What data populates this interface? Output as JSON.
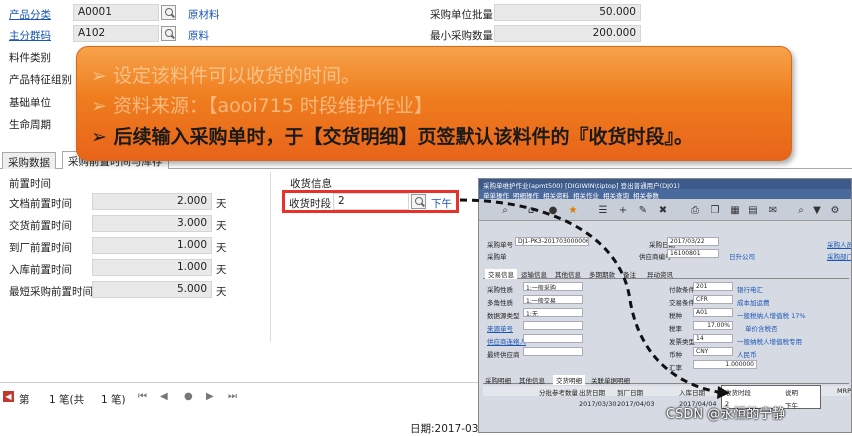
{
  "top_form": {
    "product_category": {
      "label": "产品分类",
      "value": "A0001",
      "desc": "原材料"
    },
    "main_group": {
      "label": "主分群码",
      "value": "A102",
      "desc": "原料"
    },
    "material_type_label": "料件类别",
    "product_feature_label": "产品特征组别",
    "base_unit_label": "基础单位",
    "lifecycle_label": "生命周期",
    "purchase_batch": {
      "label": "采购单位批量",
      "value": "50.000"
    },
    "min_purchase": {
      "label": "最小采购数量",
      "value": "200.000"
    }
  },
  "overlay": {
    "line1": "➢ 设定该料件可以收货的时间。",
    "line2": "➢ 资料来源：【aooi715 时段维护作业】",
    "line3": "➢ 后续输入采购单时，于【交货明细】页签默认该料件的『收货时段』。"
  },
  "tabs": [
    "采购数据",
    "采购前置时间与库存"
  ],
  "lead_time": {
    "section_title": "前置时间",
    "rows": [
      {
        "label": "文档前置时间",
        "value": "2.000",
        "unit": "天"
      },
      {
        "label": "交货前置时间",
        "value": "3.000",
        "unit": "天"
      },
      {
        "label": "到厂前置时间",
        "value": "1.000",
        "unit": "天"
      },
      {
        "label": "入库前置时间",
        "value": "1.000",
        "unit": "天"
      },
      {
        "label": "最短采购前置时间",
        "value": "5.000",
        "unit": "天"
      }
    ]
  },
  "receipt": {
    "section_title": "收货信息",
    "slot_label": "收货时段",
    "slot_value": "2",
    "slot_desc": "下午"
  },
  "nav": {
    "first_label": "第",
    "position": "1 笔(共",
    "total": "1 笔)"
  },
  "date_label": "日期:2017-03-",
  "watermark": "CSDN @永恒的宁静",
  "inset": {
    "title": "采购单维护作业(apmt500)  [DIGIWIN\\tiptop]  登出普通用户(DJ01)",
    "menu": [
      "单单操作",
      "明细操作",
      "相关资料",
      "相关作业",
      "相关查询",
      "相关参数"
    ],
    "po_no_label": "采购单号",
    "po_no": "DJ1-PK3-201703000006",
    "po_date_label": "采购日期",
    "po_date": "2017/03/22",
    "supplier_label": "供应商编号",
    "supplier": "16100801",
    "supplier_name": "日升公司",
    "po_type": "采购单",
    "right_links": [
      "采购人员",
      "采购部门"
    ],
    "tabs": [
      "交易信息",
      "运输信息",
      "其他信息",
      "多期期款",
      "备注",
      "异动资讯"
    ],
    "left_rows": [
      {
        "label": "采购性质",
        "value": "1:一般采购"
      },
      {
        "label": "多角性质",
        "value": "1:一般交易"
      },
      {
        "label": "数据源类型",
        "value": "1:无"
      },
      {
        "label": "来源单号",
        "value": ""
      },
      {
        "label": "供应商连络人",
        "value": ""
      },
      {
        "label": "最终供应商",
        "value": ""
      }
    ],
    "right_rows": [
      {
        "label": "付款条件",
        "value": "201",
        "desc": "银行电汇"
      },
      {
        "label": "交易条件",
        "value": "CFR",
        "desc": "成本加运费"
      },
      {
        "label": "税种",
        "value": "A01",
        "desc": "一般税纳人增值税 17%"
      },
      {
        "label": "税率",
        "value": "17.00%",
        "desc": "单价含税否"
      },
      {
        "label": "发票类型",
        "value": "14",
        "desc": "一般纳税人增值税专用"
      },
      {
        "label": "币种",
        "value": "CNY",
        "desc": "人民币"
      },
      {
        "label": "汇率",
        "value": "1.000000",
        "desc": ""
      }
    ],
    "bottom_tabs": [
      "采购明细",
      "其他信息",
      "交货明细",
      "关联单据明细"
    ],
    "grid_headers": [
      "分批参考数量",
      "出货日期",
      "到厂日期",
      "入库日期",
      "收货时段",
      "说明",
      "MRP"
    ],
    "grid_row": [
      "",
      "2017/03/30",
      "2017/04/03",
      "2017/04/04",
      "2",
      "下午",
      ""
    ]
  }
}
